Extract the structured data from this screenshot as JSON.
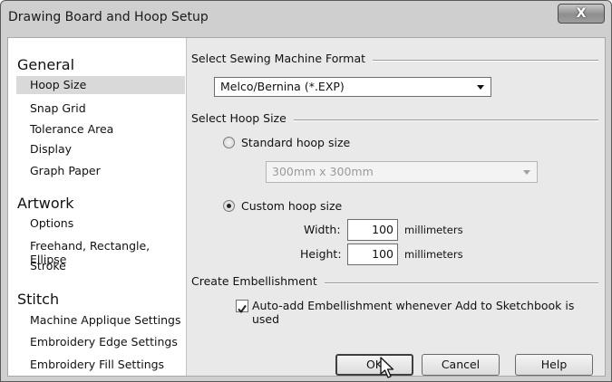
{
  "window": {
    "title": "Drawing Board and Hoop Setup",
    "close_glyph": "X"
  },
  "sidebar": {
    "categories": [
      {
        "label": "General",
        "items": [
          "Hoop Size",
          "Snap Grid",
          "Tolerance Area",
          "Display",
          "Graph Paper"
        ]
      },
      {
        "label": "Artwork",
        "items": [
          "Options",
          "Freehand, Rectangle, Ellipse",
          "Stroke"
        ]
      },
      {
        "label": "Stitch",
        "items": [
          "Machine Applique Settings",
          "Embroidery Edge Settings",
          "Embroidery Fill Settings"
        ]
      }
    ],
    "selected": "Hoop Size"
  },
  "main": {
    "format_section": {
      "label": "Select Sewing Machine  Format",
      "value": "Melco/Bernina (*.EXP)"
    },
    "hoop_section": {
      "label": "Select Hoop Size",
      "standard_label": "Standard hoop size",
      "standard_value": "300mm x 300mm",
      "standard_selected": false,
      "custom_label": "Custom hoop size",
      "custom_selected": true,
      "width_label": "Width:",
      "width_value": "100",
      "height_label": "Height:",
      "height_value": "100",
      "units": "millimeters"
    },
    "embellishment_section": {
      "label": "Create Embellishment",
      "checkbox_label": "Auto-add Embellishment whenever Add to Sketchbook is used",
      "checked": true
    },
    "buttons": {
      "ok": "OK",
      "cancel": "Cancel",
      "help": "Help"
    }
  }
}
